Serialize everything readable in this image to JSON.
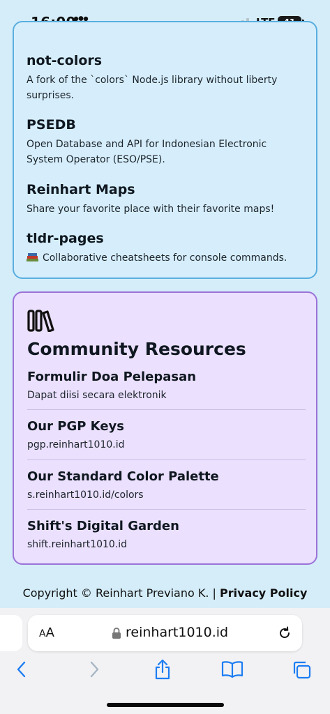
{
  "status_bar": {
    "time": "16:00",
    "network": "LTE",
    "battery": "41",
    "icons": [
      "people-icon",
      "signal-icon",
      "battery-icon"
    ]
  },
  "projects": [
    {
      "title": "not-colors",
      "description": "A fork of the `colors` Node.js library without liberty surprises."
    },
    {
      "title": "PSEDB",
      "description": "Open Database and API for Indonesian Electronic System Operator (ESO/PSE)."
    },
    {
      "title": "Reinhart Maps",
      "description": "Share your favorite place with their favorite maps!"
    },
    {
      "title": "tldr-pages",
      "emoji": "📚",
      "description": "Collaborative cheatsheets for console commands."
    }
  ],
  "community": {
    "icon": "library-icon",
    "title": "Community Resources",
    "resources": [
      {
        "title": "Formulir Doa Pelepasan",
        "subtitle": "Dapat diisi secara elektronik"
      },
      {
        "title": "Our PGP Keys",
        "subtitle": "pgp.reinhart1010.id"
      },
      {
        "title": "Our Standard Color Palette",
        "subtitle": "s.reinhart1010.id/colors"
      },
      {
        "title": "Shift's Digital Garden",
        "subtitle": "shift.reinhart1010.id"
      }
    ]
  },
  "footer": {
    "copyright": "Copyright © Reinhart Previano K. |",
    "privacy_link": "Privacy Policy"
  },
  "browser": {
    "aa_large": "A",
    "aa_small": "A",
    "url": "reinhart1010.id"
  },
  "colors": {
    "page_bg": "#d4edf9",
    "projects_border": "#5aaee0",
    "community_bg": "#ebe0fd",
    "community_border": "#9a72d8",
    "toolbar_accent": "#1d7df2"
  }
}
